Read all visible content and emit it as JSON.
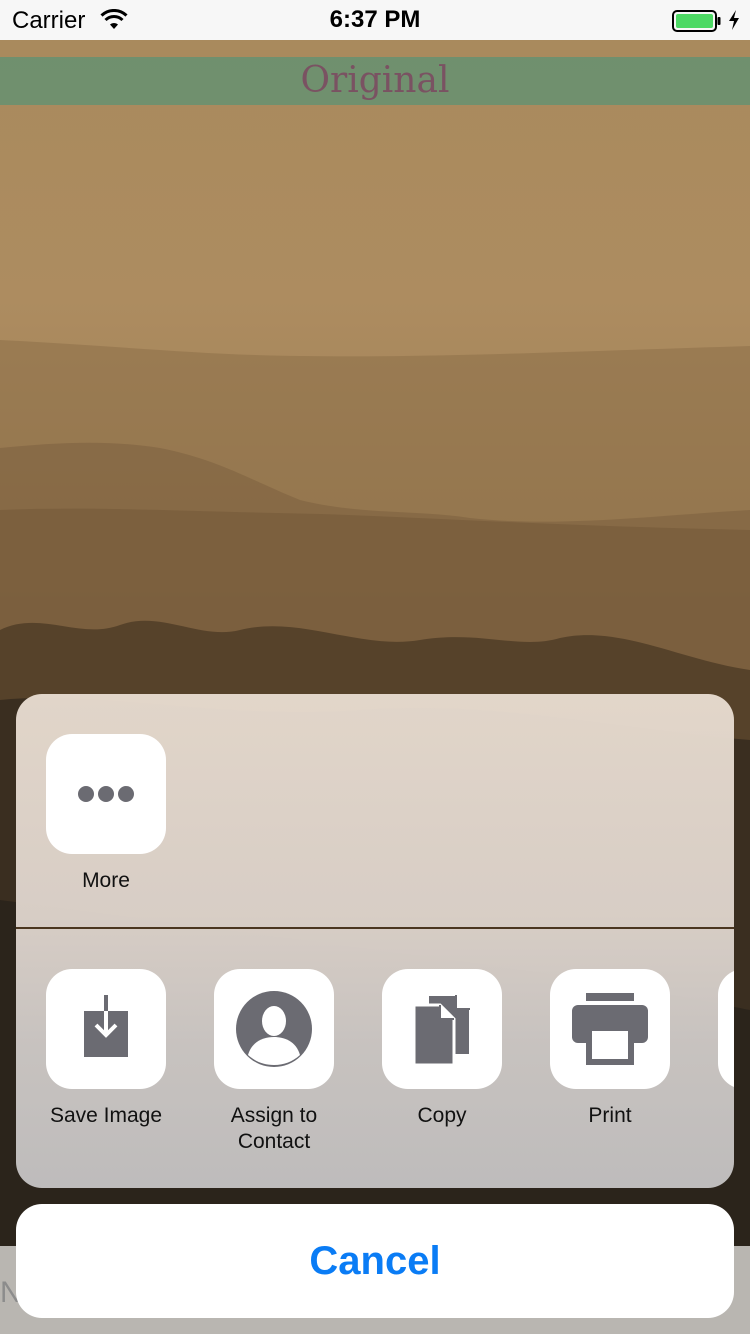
{
  "status_bar": {
    "carrier": "Carrier",
    "time": "6:37 PM",
    "battery_color": "#4cd964"
  },
  "photo": {
    "title": "Original",
    "bottom_text": "N"
  },
  "share_sheet": {
    "top_row": [
      {
        "label": "More",
        "icon": "more-dots-icon"
      }
    ],
    "actions": [
      {
        "label": "Save Image",
        "icon": "save-image-icon"
      },
      {
        "label": "Assign to\nContact",
        "icon": "contact-icon"
      },
      {
        "label": "Copy",
        "icon": "copy-icon"
      },
      {
        "label": "Print",
        "icon": "print-icon"
      }
    ],
    "cancel_label": "Cancel",
    "accent_color": "#0a7cf5",
    "icon_color": "#6b6b72"
  }
}
